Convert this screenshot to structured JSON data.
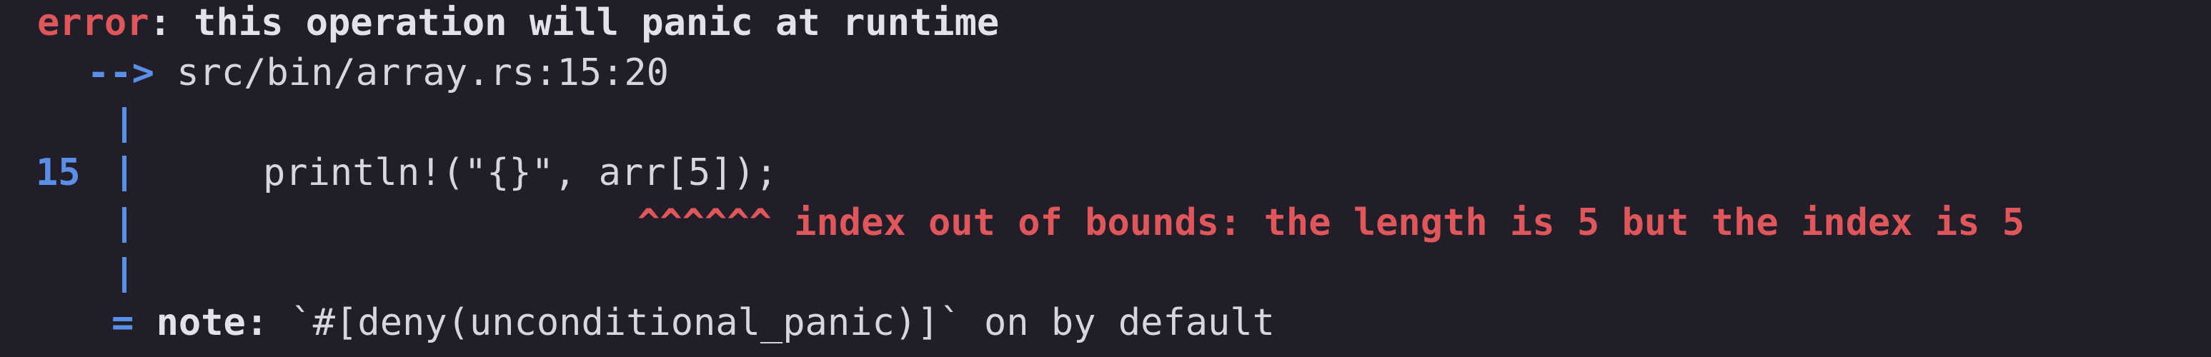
{
  "error": {
    "label": "error",
    "message": ": this operation will panic at runtime"
  },
  "location": {
    "arrow": "-->",
    "path": "src/bin/array.rs:15:20"
  },
  "source": {
    "line_number": "15",
    "code": "println!(\"{}\", arr[5]);"
  },
  "annotation": {
    "carets": "^^^^^^",
    "message": "index out of bounds: the length is 5 but the index is 5"
  },
  "note": {
    "equals": "=",
    "label": "note:",
    "text": " `#[deny(unconditional_panic)]` on by default"
  },
  "colors": {
    "background": "#211e2a",
    "error": "#e0575b",
    "gutter": "#5b8ee6",
    "text": "#d6d6dc"
  }
}
